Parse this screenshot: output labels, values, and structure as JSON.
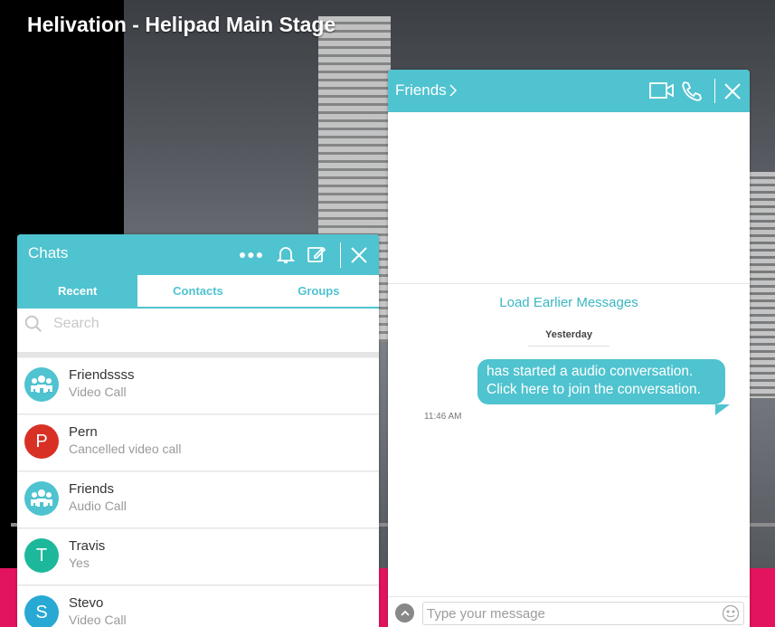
{
  "stage": {
    "title": "Helivation - Helipad Main Stage",
    "colors": {
      "accent": "#4fc3cf",
      "brand_bar": "#e3145f"
    }
  },
  "chats_panel": {
    "title": "Chats",
    "header_icons": [
      "more-icon",
      "bell-icon",
      "edit-icon",
      "close-icon"
    ],
    "tabs": [
      {
        "label": "Recent",
        "active": true
      },
      {
        "label": "Contacts",
        "active": false
      },
      {
        "label": "Groups",
        "active": false
      }
    ],
    "search": {
      "placeholder": "Search",
      "value": ""
    },
    "items": [
      {
        "name": "Friendssss",
        "subtitle": "Video Call",
        "avatar": "group-icon",
        "avatar_color": "#4fc3cf"
      },
      {
        "name": "Pern",
        "subtitle": "Cancelled video call",
        "avatar": "P",
        "avatar_color": "#d93025"
      },
      {
        "name": "Friends",
        "subtitle": "Audio Call",
        "avatar": "group-icon",
        "avatar_color": "#4fc3cf"
      },
      {
        "name": "Travis",
        "subtitle": "Yes",
        "avatar": "T",
        "avatar_color": "#1db89b"
      },
      {
        "name": "Stevo",
        "subtitle": "Video Call",
        "avatar": "S",
        "avatar_color": "#27a9d3"
      }
    ]
  },
  "friends_panel": {
    "title": "Friends",
    "header_icons": [
      "video-call-icon",
      "phone-icon",
      "close-icon"
    ],
    "load_earlier": "Load Earlier Messages",
    "day_label": "Yesterday",
    "message": {
      "text": "has started a audio conversation. Click here to join the conversation.",
      "time": "11:46 AM"
    },
    "composer": {
      "placeholder": "Type your message",
      "value": ""
    }
  }
}
